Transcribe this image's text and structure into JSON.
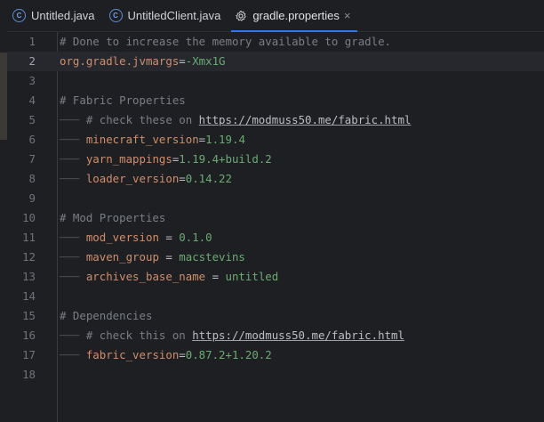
{
  "tabs": [
    {
      "label": "Untitled.java",
      "icon": "java-class-icon",
      "active": false
    },
    {
      "label": "UntitledClient.java",
      "icon": "java-class-icon",
      "active": false
    },
    {
      "label": "gradle.properties",
      "icon": "gear-icon",
      "active": true,
      "close": "×"
    }
  ],
  "editor": {
    "current_line": 2,
    "lines": [
      {
        "n": "1",
        "comment": "# Done to increase the memory available to gradle."
      },
      {
        "n": "2",
        "key": "org.gradle.jvmargs",
        "eq": "=",
        "value": "-Xmx1G"
      },
      {
        "n": "3"
      },
      {
        "n": "4",
        "comment": "# Fabric Properties"
      },
      {
        "n": "5",
        "comment": "# check these on ",
        "url": "https://modmuss50.me/fabric.html"
      },
      {
        "n": "6",
        "key": "minecraft_version",
        "eq": "=",
        "value": "1.19.4"
      },
      {
        "n": "7",
        "key": "yarn_mappings",
        "eq": "=",
        "value": "1.19.4+build.2"
      },
      {
        "n": "8",
        "key": "loader_version",
        "eq": "=",
        "value": "0.14.22"
      },
      {
        "n": "9"
      },
      {
        "n": "10",
        "comment": "# Mod Properties"
      },
      {
        "n": "11",
        "key": "mod_version",
        "eq": " = ",
        "value": "0.1.0"
      },
      {
        "n": "12",
        "key": "maven_group",
        "eq": " = ",
        "value": "macstevins"
      },
      {
        "n": "13",
        "key": "archives_base_name",
        "eq": " = ",
        "value": "untitled"
      },
      {
        "n": "14"
      },
      {
        "n": "15",
        "comment": "# Dependencies"
      },
      {
        "n": "16",
        "comment": "# check this on ",
        "url": "https://modmuss50.me/fabric.html"
      },
      {
        "n": "17",
        "key": "fabric_version",
        "eq": "=",
        "value": "0.87.2+1.20.2"
      },
      {
        "n": "18"
      }
    ]
  }
}
